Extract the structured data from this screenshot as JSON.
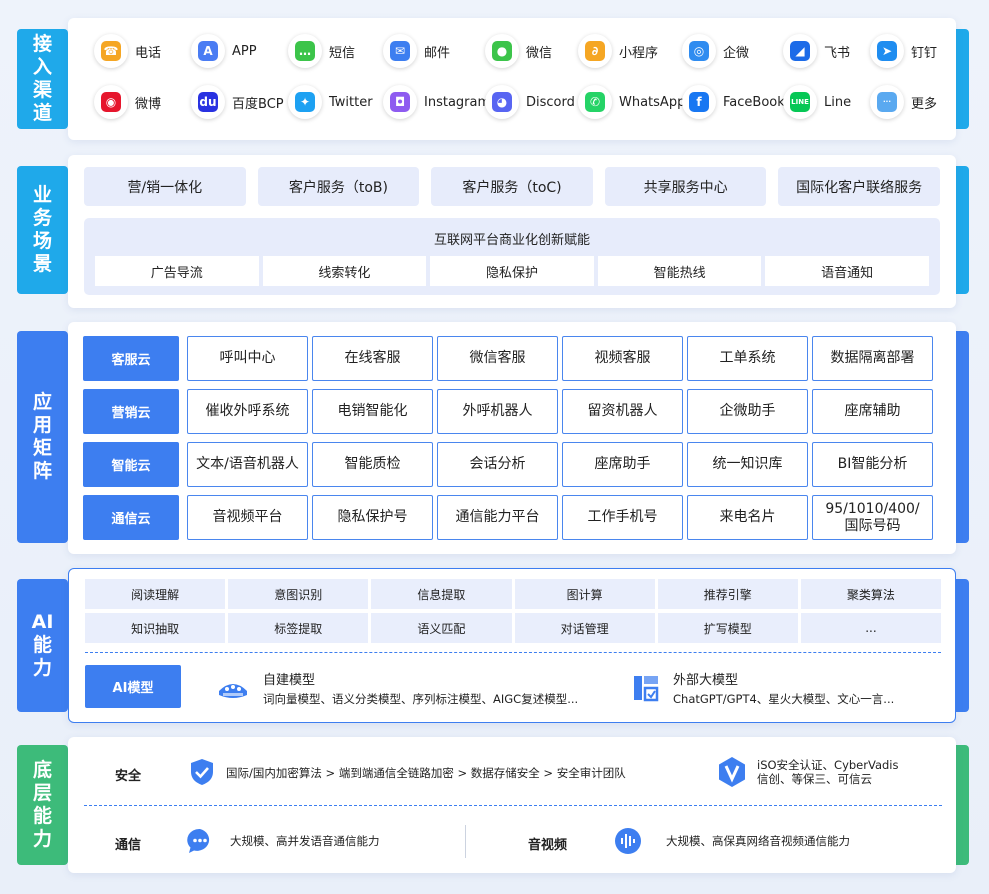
{
  "channels": {
    "label": "接入渠道",
    "items": [
      {
        "label": "电话",
        "icon": "phone-icon",
        "color": "#f5a623",
        "glyph": "☎"
      },
      {
        "label": "APP",
        "icon": "app-store-icon",
        "color": "#4a7cf3",
        "glyph": "A"
      },
      {
        "label": "短信",
        "icon": "sms-icon",
        "color": "#3cc44a",
        "glyph": "…"
      },
      {
        "label": "邮件",
        "icon": "mail-icon",
        "color": "#3d7ef0",
        "glyph": "✉"
      },
      {
        "label": "微信",
        "icon": "wechat-icon",
        "color": "#3cc44a",
        "glyph": "●"
      },
      {
        "label": "小程序",
        "icon": "mini-program-icon",
        "color": "#f5a623",
        "glyph": "∂"
      },
      {
        "label": "企微",
        "icon": "wecom-icon",
        "color": "#2f8cf0",
        "glyph": "◎"
      },
      {
        "label": "飞书",
        "icon": "feishu-icon",
        "color": "#1c6be8",
        "glyph": "◢"
      },
      {
        "label": "钉钉",
        "icon": "dingtalk-icon",
        "color": "#1f8df0",
        "glyph": "➤"
      },
      {
        "label": "微博",
        "icon": "weibo-icon",
        "color": "#e6162d",
        "glyph": "◉"
      },
      {
        "label": "百度BCP",
        "icon": "baidu-icon",
        "color": "#2932e1",
        "glyph": "du"
      },
      {
        "label": "Twitter",
        "icon": "twitter-icon",
        "color": "#1da1f2",
        "glyph": "✦"
      },
      {
        "label": "Instagram",
        "icon": "instagram-icon",
        "color": "#8e5bf0",
        "glyph": "◘"
      },
      {
        "label": "Discord",
        "icon": "discord-icon",
        "color": "#5865f2",
        "glyph": "◕"
      },
      {
        "label": "WhatsApp",
        "icon": "whatsapp-icon",
        "color": "#25d366",
        "glyph": "✆"
      },
      {
        "label": "FaceBook",
        "icon": "facebook-icon",
        "color": "#1877f2",
        "glyph": "f"
      },
      {
        "label": "Line",
        "icon": "line-icon",
        "color": "#06c755",
        "glyph": "LINE"
      },
      {
        "label": "更多",
        "icon": "more-icon",
        "color": "#5aa9f0",
        "glyph": "···"
      }
    ]
  },
  "scenes": {
    "label": "业务场景",
    "top": [
      "营/销一体化",
      "客户服务（toB)",
      "客户服务（toC)",
      "共享服务中心",
      "国际化客户联络服务"
    ],
    "innovation_title": "互联网平台商业化创新赋能",
    "innovation_items": [
      "广告导流",
      "线索转化",
      "隐私保护",
      "智能热线",
      "语音通知"
    ]
  },
  "matrix": {
    "label": "应用矩阵",
    "rows": [
      {
        "head": "客服云",
        "cells": [
          "呼叫中心",
          "在线客服",
          "微信客服",
          "视频客服",
          "工单系统",
          "数据隔离部署"
        ]
      },
      {
        "head": "营销云",
        "cells": [
          "催收外呼系统",
          "电销智能化",
          "外呼机器人",
          "留资机器人",
          "企微助手",
          "座席辅助"
        ]
      },
      {
        "head": "智能云",
        "cells": [
          "文本/语音机器人",
          "智能质检",
          "会话分析",
          "座席助手",
          "统一知识库",
          "BI智能分析"
        ]
      },
      {
        "head": "通信云",
        "cells": [
          "音视频平台",
          "隐私保护号",
          "通信能力平台",
          "工作手机号",
          "来电名片",
          "95/1010/400/国际号码"
        ]
      }
    ]
  },
  "ai": {
    "label": "AI能力",
    "capabilities": [
      "阅读理解",
      "意图识别",
      "信息提取",
      "图计算",
      "推荐引擎",
      "聚类算法",
      "知识抽取",
      "标签提取",
      "语义匹配",
      "对话管理",
      "扩写模型",
      "..."
    ],
    "model_button": "AI模型",
    "self_model": {
      "title": "自建模型",
      "desc": "词向量模型、语义分类模型、序列标注模型、AIGC复述模型..."
    },
    "external_model": {
      "title": "外部大模型",
      "desc": "ChatGPT/GPT4、星火大模型、文心一言..."
    }
  },
  "base": {
    "label": "底层能力",
    "security_label": "安全",
    "security_chain": "国际/国内加密算法 > 端到端通信全链路加密 > 数据存储安全 > 安全审计团队",
    "cert_line1": "iSO安全认证、CyberVadis",
    "cert_line2": "信创、等保三、可信云",
    "comm_label": "通信",
    "comm_text": "大规模、高并发语音通信能力",
    "av_label": "音视频",
    "av_text": "大规模、高保真网络音视频通信能力"
  }
}
